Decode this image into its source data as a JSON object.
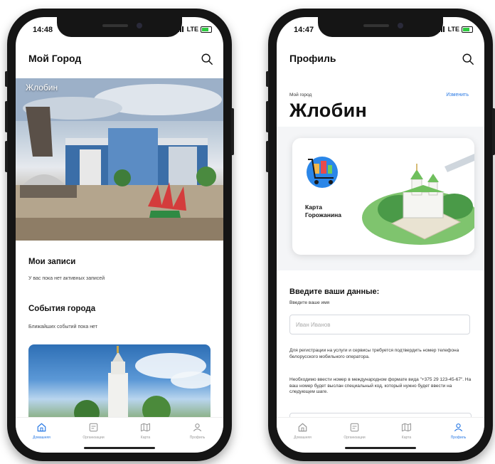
{
  "left": {
    "time": "14:48",
    "network": "LTE",
    "title": "Мой Город",
    "hero_city": "Жлобин",
    "my_records": {
      "title": "Мои записи",
      "text": "У вас пока нет активных записей"
    },
    "city_events": {
      "title": "События города",
      "text": "Ближайших событий пока нет"
    },
    "tabs": [
      {
        "label": "Домашняя",
        "icon": "home-icon",
        "active": true
      },
      {
        "label": "Организации",
        "icon": "organizations-icon",
        "active": false
      },
      {
        "label": "Карта",
        "icon": "map-icon",
        "active": false
      },
      {
        "label": "Профиль",
        "icon": "profile-icon",
        "active": false
      }
    ]
  },
  "right": {
    "time": "14:47",
    "network": "LTE",
    "title": "Профиль",
    "my_city_label": "Мой город",
    "change_link": "Изменить",
    "city": "Жлобин",
    "card_label_line1": "Карта",
    "card_label_line2": "Горожанина",
    "form_title": "Введите ваши данные:",
    "name_label": "Введите ваше имя",
    "name_placeholder": "Иван Иванов",
    "info_text_1": "Для регистрации на услуги и сервисы требуется подтвердить номер телефона белорусского мобильного оператора.",
    "info_text_2": "Необходимо ввести номер в международном формате вида \"+375 29 123-45-67\". На ваш номер будет выслан специальный код, который нужно будет ввести на следующем шаге.",
    "tabs": [
      {
        "label": "Домашняя",
        "icon": "home-icon",
        "active": false
      },
      {
        "label": "Организации",
        "icon": "organizations-icon",
        "active": false
      },
      {
        "label": "Карта",
        "icon": "map-icon",
        "active": false
      },
      {
        "label": "Профиль",
        "icon": "profile-icon",
        "active": true
      }
    ]
  },
  "colors": {
    "accent": "#2a7ae4",
    "phone_frame": "#151515"
  }
}
